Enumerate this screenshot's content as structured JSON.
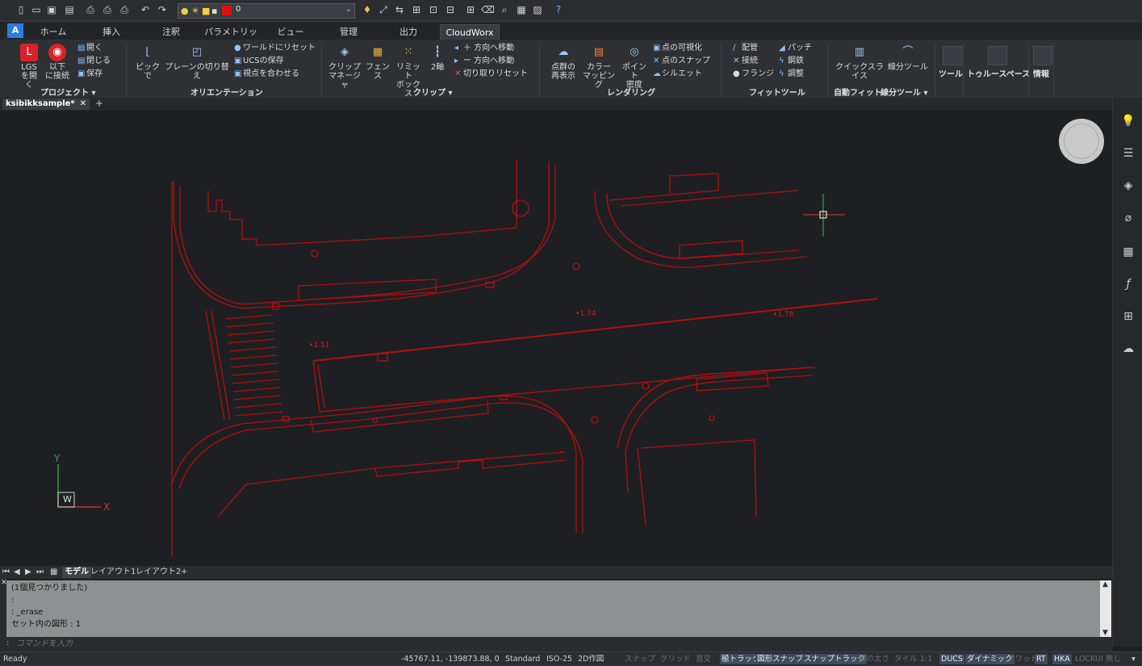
{
  "quick_access": {
    "icons": [
      "new-icon",
      "open-icon",
      "save-icon",
      "save-as-icon",
      "plot-icon",
      "print-preview-icon",
      "publish-icon",
      "undo-icon",
      "redo-icon"
    ],
    "layer_value": "0",
    "layer_color": "#e01010"
  },
  "tabs": [
    "ホーム",
    "挿入",
    "注釈",
    "パラメトリック",
    "ビュー",
    "管理",
    "出力",
    "CloudWorx"
  ],
  "active_tab": "CloudWorx",
  "ribbon": {
    "project": {
      "lgs_open": "LGS\nを開く",
      "connect": "以下\nに接続",
      "open": "開く",
      "close": "閉じる",
      "save": "保存",
      "group": "プロジェクト"
    },
    "orientation": {
      "pick": "ピックで",
      "plane_switch": "プレーンの切り替え",
      "reset_world": "ワールドにリセット",
      "save_ucs": "UCSの保存",
      "align_view": "視点を合わせる",
      "group": "オリエンテーション"
    },
    "clip": {
      "clip_manager": "クリップ\nマネージャ",
      "fence": "フェンス",
      "limit_box": "リミット\nボックス",
      "axis2": "2軸",
      "move_plus": "＋ 方向へ移動",
      "move_minus": "ー 方向へ移動",
      "reset_cut": "切り取りリセット",
      "group": "クリップ"
    },
    "rendering": {
      "point_display": "点群の\n再表示",
      "color_mapping": "カラー\nマッピング",
      "point_density": "ポイント\n密度",
      "points_visualize": "点の可視化",
      "points_snap": "点のスナップ",
      "silhouette": "シルエット",
      "group": "レンダリング"
    },
    "fit": {
      "piping": "配管",
      "connect": "接続",
      "flange": "フランジ",
      "patch": "パッチ",
      "steel": "鋼鉄",
      "adjust": "調整",
      "group": "フィットツール"
    },
    "auto_fit": {
      "quick_slice": "クイックスライス",
      "line_tool": "線分ツール",
      "group": "自動フィット",
      "group2": "線分ツール"
    },
    "tool": "ツール",
    "truespace": "トゥルースペース",
    "info": "情報"
  },
  "document_tab": "ksibikksample*",
  "drawing": {
    "elev_1": "1.51",
    "elev_2": "1.74",
    "elev_3": "1.78",
    "line_color": "#b01010",
    "ucs_y": "Y",
    "ucs_x": "X",
    "ucs_w": "W"
  },
  "right_panel_icons": [
    "lightbulb-icon",
    "properties-icon",
    "layers-icon",
    "attach-icon",
    "pattern-icon",
    "function-icon",
    "tree-icon",
    "cloud-icon"
  ],
  "layout_tabs": [
    "モデル",
    "レイアウト1",
    "レイアウト2"
  ],
  "command_history": [
    "(1個見つかりました)",
    ":",
    ": _erase",
    "セット内の図形 : 1"
  ],
  "command_prompt": "コマンドを入力",
  "status": {
    "ready": "Ready",
    "coords": "-45767.11, -139873.88, 0",
    "style": "Standard",
    "dimstyle": "ISO-25",
    "view": "2D作図",
    "toggles": [
      {
        "label": "スナップ",
        "on": false
      },
      {
        "label": "グリッド",
        "on": false
      },
      {
        "label": "直交",
        "on": false
      },
      {
        "label": "極トラック",
        "on": true
      },
      {
        "label": "図形スナップ",
        "on": true
      },
      {
        "label": "スナップトラック",
        "on": true
      },
      {
        "label": "線の太さ",
        "on": false
      },
      {
        "label": "タイル",
        "on": false
      },
      {
        "label": "1:1",
        "on": false
      },
      {
        "label": "DUCS",
        "on": true
      },
      {
        "label": "ダイナミック",
        "on": true
      },
      {
        "label": "クワッド",
        "on": false
      },
      {
        "label": "RT",
        "on": true
      },
      {
        "label": "HKA",
        "on": true
      },
      {
        "label": "LOCKUI",
        "on": false
      },
      {
        "label": "無し",
        "on": false
      }
    ]
  }
}
